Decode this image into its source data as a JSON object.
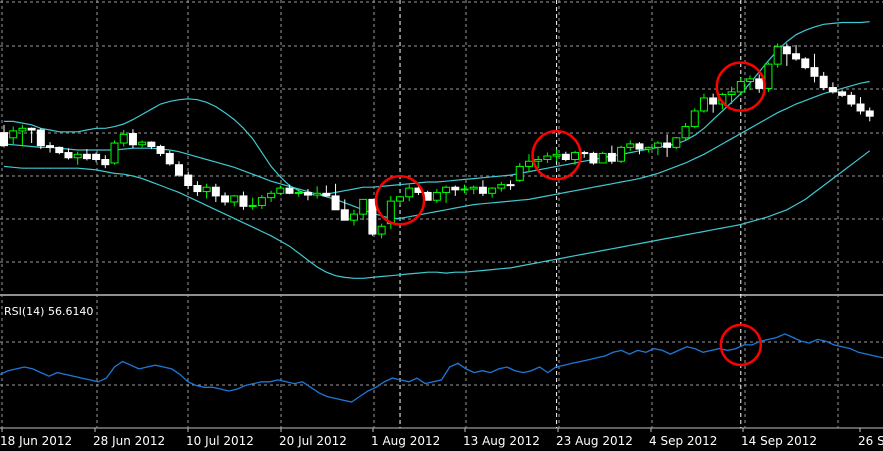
{
  "chart_data": {
    "type": "candlestick",
    "instrument_title": "",
    "x_ticks": [
      "18 Jun 2012",
      "28 Jun 2012",
      "10 Jul 2012",
      "20 Jul 2012",
      "1 Aug 2012",
      "13 Aug 2012",
      "23 Aug 2012",
      "4 Sep 2012",
      "14 Sep 2012",
      "26 S"
    ],
    "y_range": [
      0,
      100
    ],
    "grid": true,
    "colors": {
      "background": "#000000",
      "grid": "#9a9a9a",
      "bullish_candle": "#00ff00",
      "bearish_candle": "#ffffff",
      "bollinger_bands": "#40c8d0",
      "rsi_line": "#1e78d8",
      "highlight_circle": "#ff0000",
      "text": "#ffffff"
    },
    "candles": [
      [
        75,
        84,
        58,
        60
      ],
      [
        69,
        82,
        61,
        77
      ],
      [
        77,
        84,
        59,
        80
      ],
      [
        80,
        81,
        63,
        78
      ],
      [
        78,
        80,
        56,
        60
      ],
      [
        60,
        64,
        52,
        58
      ],
      [
        58,
        59,
        50,
        52
      ],
      [
        52,
        57,
        44,
        46
      ],
      [
        46,
        53,
        38,
        50
      ],
      [
        50,
        56,
        43,
        45
      ],
      [
        50,
        52,
        41,
        44
      ],
      [
        44,
        49,
        34,
        38
      ],
      [
        40,
        66,
        38,
        63
      ],
      [
        63,
        78,
        59,
        73
      ],
      [
        74,
        79,
        57,
        61
      ],
      [
        61,
        66,
        58,
        64
      ],
      [
        64,
        65,
        56,
        59
      ],
      [
        59,
        61,
        48,
        51
      ],
      [
        51,
        54,
        37,
        39
      ],
      [
        38,
        42,
        24,
        26
      ],
      [
        26,
        30,
        10,
        14
      ],
      [
        14,
        19,
        2,
        7
      ],
      [
        7,
        16,
        -1,
        12
      ],
      [
        12,
        16,
        -5,
        2
      ],
      [
        2,
        6,
        -9,
        -5
      ],
      [
        -5,
        3,
        -10,
        2
      ],
      [
        2,
        7,
        -14,
        -10
      ],
      [
        -10,
        0,
        -14,
        -9
      ],
      [
        -9,
        3,
        -13,
        0
      ],
      [
        0,
        8,
        -5,
        5
      ],
      [
        5,
        14,
        3,
        11
      ],
      [
        11,
        15,
        4,
        5
      ],
      [
        5,
        10,
        1,
        6
      ],
      [
        6,
        10,
        -3,
        3
      ],
      [
        3,
        13,
        -1,
        5
      ],
      [
        5,
        14,
        1,
        2
      ],
      [
        2,
        16,
        -3,
        -14
      ],
      [
        -14,
        -2,
        -26,
        -26
      ],
      [
        -26,
        -14,
        -32,
        -19
      ],
      [
        -19,
        -2,
        -26,
        -2
      ],
      [
        -2,
        -2,
        -44,
        -42
      ],
      [
        -42,
        -30,
        -47,
        -33
      ],
      [
        -30,
        2,
        -36,
        -4
      ],
      [
        -4,
        2,
        -8,
        1
      ],
      [
        1,
        15,
        -4,
        11
      ],
      [
        11,
        13,
        3,
        6
      ],
      [
        6,
        8,
        -3,
        -3
      ],
      [
        -3,
        10,
        -6,
        6
      ],
      [
        6,
        14,
        -6,
        12
      ],
      [
        12,
        14,
        2,
        9
      ],
      [
        9,
        15,
        5,
        10
      ],
      [
        10,
        14,
        4,
        12
      ],
      [
        12,
        20,
        2,
        5
      ],
      [
        5,
        12,
        0,
        11
      ],
      [
        11,
        18,
        7,
        15
      ],
      [
        15,
        20,
        9,
        14
      ],
      [
        20,
        40,
        18,
        36
      ],
      [
        36,
        50,
        30,
        42
      ],
      [
        42,
        48,
        34,
        44
      ],
      [
        44,
        52,
        40,
        48
      ],
      [
        48,
        56,
        42,
        50
      ],
      [
        50,
        53,
        42,
        44
      ],
      [
        44,
        54,
        38,
        52
      ],
      [
        52,
        54,
        46,
        51
      ],
      [
        51,
        53,
        38,
        40
      ],
      [
        40,
        53,
        40,
        51
      ],
      [
        51,
        60,
        39,
        42
      ],
      [
        42,
        60,
        40,
        58
      ],
      [
        58,
        66,
        54,
        62
      ],
      [
        62,
        64,
        50,
        56
      ],
      [
        56,
        59,
        52,
        58
      ],
      [
        58,
        65,
        49,
        63
      ],
      [
        63,
        73,
        47,
        58
      ],
      [
        58,
        70,
        56,
        69
      ],
      [
        69,
        86,
        66,
        82
      ],
      [
        82,
        103,
        80,
        100
      ],
      [
        100,
        120,
        98,
        115
      ],
      [
        115,
        120,
        98,
        108
      ],
      [
        108,
        121,
        102,
        119
      ],
      [
        119,
        128,
        108,
        122
      ],
      [
        122,
        138,
        118,
        134
      ],
      [
        134,
        141,
        124,
        137
      ],
      [
        137,
        142,
        121,
        126
      ],
      [
        126,
        156,
        122,
        154
      ],
      [
        154,
        178,
        150,
        174
      ],
      [
        174,
        178,
        152,
        166
      ],
      [
        166,
        176,
        158,
        160
      ],
      [
        160,
        162,
        148,
        150
      ],
      [
        150,
        166,
        133,
        140
      ],
      [
        140,
        145,
        124,
        127
      ],
      [
        127,
        133,
        120,
        122
      ],
      [
        122,
        124,
        116,
        118
      ],
      [
        118,
        122,
        105,
        108
      ],
      [
        108,
        116,
        96,
        100
      ],
      [
        100,
        104,
        88,
        94
      ]
    ],
    "bollinger_bands": {
      "upper": [
        88,
        88,
        86,
        84,
        80,
        78,
        76,
        76,
        76,
        78,
        80,
        80,
        82,
        85,
        90,
        96,
        102,
        108,
        111,
        113,
        114,
        113,
        110,
        105,
        98,
        90,
        80,
        68,
        52,
        36,
        24,
        14,
        8,
        4,
        3,
        4,
        6,
        8,
        10,
        12,
        12,
        13,
        14,
        15,
        16,
        17,
        18,
        18,
        19,
        20,
        21,
        22,
        23,
        24,
        25,
        26,
        28,
        30,
        32,
        34,
        36,
        38,
        40,
        42,
        44,
        46,
        48,
        50,
        52,
        54,
        56,
        58,
        60,
        62,
        66,
        72,
        80,
        90,
        100,
        110,
        120,
        132,
        145,
        158,
        170,
        180,
        188,
        193,
        197,
        200,
        201,
        202,
        202,
        202,
        203
      ],
      "middle": [
        62,
        61,
        60,
        59,
        58,
        58,
        57,
        56,
        55,
        55,
        55,
        55,
        55,
        56,
        57,
        57,
        57,
        56,
        55,
        53,
        50,
        47,
        44,
        41,
        38,
        35,
        31,
        27,
        23,
        19,
        16,
        13,
        10,
        7,
        4,
        1,
        -2,
        -6,
        -10,
        -14,
        -18,
        -21,
        -24,
        -24,
        -22,
        -20,
        -18,
        -16,
        -14,
        -12,
        -10,
        -8,
        -7,
        -6,
        -5,
        -4,
        -3,
        -2,
        0,
        2,
        4,
        6,
        8,
        10,
        12,
        14,
        16,
        18,
        20,
        22,
        25,
        28,
        32,
        36,
        40,
        45,
        50,
        56,
        62,
        68,
        74,
        80,
        86,
        92,
        98,
        103,
        108,
        112,
        116,
        120,
        123,
        126,
        129,
        132,
        134
      ],
      "lower": [
        36,
        35,
        34,
        34,
        34,
        34,
        34,
        34,
        34,
        33,
        32,
        30,
        28,
        27,
        25,
        22,
        18,
        14,
        10,
        6,
        1,
        -4,
        -9,
        -14,
        -19,
        -24,
        -29,
        -34,
        -39,
        -44,
        -50,
        -56,
        -64,
        -72,
        -80,
        -86,
        -90,
        -92,
        -93,
        -93,
        -92,
        -91,
        -90,
        -89,
        -88,
        -87,
        -86,
        -86,
        -87,
        -86,
        -86,
        -85,
        -84,
        -83,
        -82,
        -81,
        -79,
        -77,
        -75,
        -73,
        -71,
        -69,
        -67,
        -65,
        -63,
        -61,
        -59,
        -57,
        -55,
        -53,
        -51,
        -49,
        -47,
        -45,
        -43,
        -41,
        -39,
        -37,
        -35,
        -33,
        -31,
        -28,
        -25,
        -22,
        -18,
        -14,
        -8,
        -2,
        6,
        14,
        22,
        30,
        38,
        46,
        54
      ]
    },
    "rsi": {
      "label": "RSI(14) 56.6140",
      "period": 14,
      "value": 56.614,
      "values": [
        48,
        50,
        51,
        52,
        51,
        49,
        47,
        49,
        48,
        47,
        46,
        45,
        44,
        46,
        52,
        55,
        53,
        51,
        52,
        53,
        52,
        51,
        48,
        44,
        42,
        41,
        41,
        40,
        39,
        40,
        42,
        43,
        44,
        44,
        45,
        44,
        43,
        44,
        41,
        38,
        36,
        35,
        34,
        33,
        36,
        39,
        41,
        44,
        46,
        45,
        44,
        46,
        43,
        44,
        45,
        52,
        54,
        51,
        49,
        50,
        49,
        51,
        52,
        50,
        49,
        50,
        52,
        49,
        52,
        53,
        54,
        55,
        56,
        57,
        58,
        60,
        61,
        59,
        61,
        60,
        62,
        61,
        59,
        61,
        63,
        62,
        60,
        61,
        62,
        61,
        62,
        64,
        64,
        66,
        67,
        68,
        70,
        68,
        66,
        65,
        67,
        66,
        64,
        63,
        62,
        60,
        59,
        58,
        57
      ]
    },
    "annotations": [
      {
        "type": "circle",
        "panel": "price",
        "candle_index": 43
      },
      {
        "type": "circle",
        "panel": "price",
        "candle_index": 60
      },
      {
        "type": "circle",
        "panel": "price",
        "candle_index": 80
      },
      {
        "type": "circle",
        "panel": "rsi",
        "candle_index": 80
      }
    ],
    "vertical_markers": [
      43,
      60,
      80
    ]
  }
}
